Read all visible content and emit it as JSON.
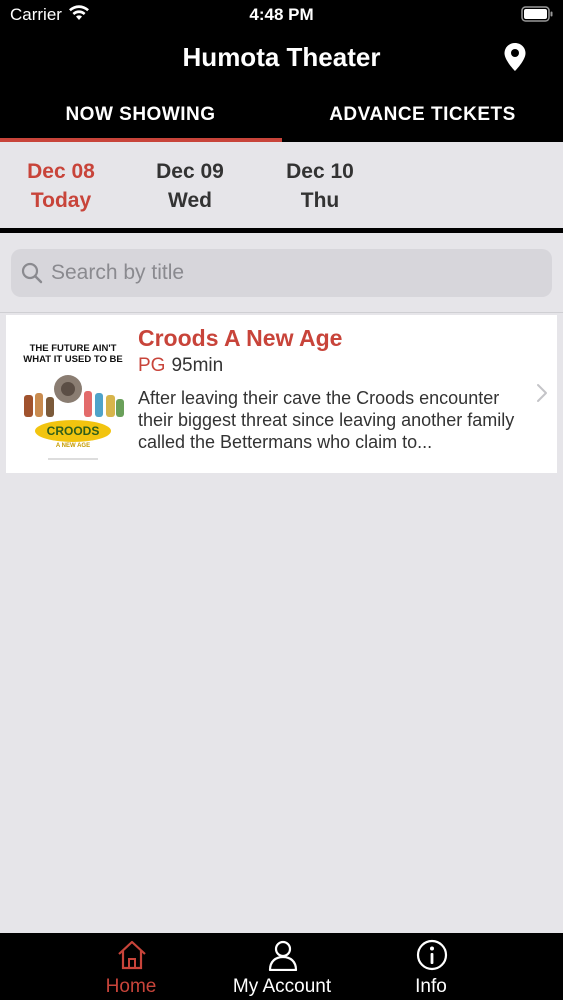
{
  "status_bar": {
    "carrier": "Carrier",
    "time": "4:48 PM"
  },
  "nav": {
    "title": "Humota Theater",
    "location_icon": "map-pin-icon"
  },
  "tabs": [
    {
      "label": "NOW SHOWING",
      "active": true
    },
    {
      "label": "ADVANCE TICKETS",
      "active": false
    }
  ],
  "dates": [
    {
      "date": "Dec 08",
      "day": "Today",
      "active": true
    },
    {
      "date": "Dec 09",
      "day": "Wed",
      "active": false
    },
    {
      "date": "Dec 10",
      "day": "Thu",
      "active": false
    }
  ],
  "search": {
    "placeholder": "Search by title",
    "value": ""
  },
  "movies": [
    {
      "title": "Croods A New Age",
      "rating": "PG",
      "runtime": "95min",
      "description": "After leaving their cave the Croods encounter their biggest threat since leaving another family called the Bettermans who claim to...",
      "poster": {
        "tagline": "THE FUTURE AIN'T WHAT IT USED TO BE",
        "logo": "CROODS",
        "sub": "A NEW AGE"
      }
    }
  ],
  "bottom_nav": [
    {
      "label": "Home",
      "icon": "home-icon",
      "active": true
    },
    {
      "label": "My Account",
      "icon": "user-icon",
      "active": false
    },
    {
      "label": "Info",
      "icon": "info-icon",
      "active": false
    }
  ],
  "colors": {
    "accent": "#c8443a",
    "bar": "#000000",
    "background": "#e6e5e9"
  }
}
